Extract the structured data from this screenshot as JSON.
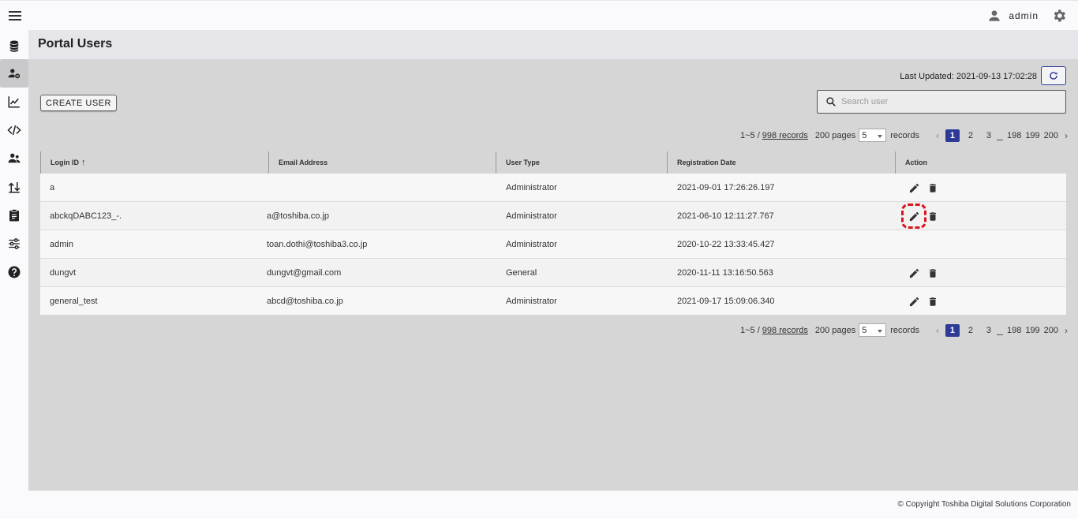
{
  "header": {
    "username": "admin"
  },
  "page": {
    "title": "Portal Users"
  },
  "toolbar": {
    "last_updated": "Last Updated: 2021-09-13 17:02:28",
    "create_label": "CREATE USER",
    "search_placeholder": "Search user"
  },
  "pagination": {
    "range": "1~5 /",
    "records_link": "998 records",
    "pages_count": "200 pages",
    "page_size": "5",
    "records_word": "records",
    "pages": [
      "1",
      "2",
      "3",
      "198",
      "199",
      "200"
    ]
  },
  "table": {
    "headers": [
      "Login ID",
      "Email Address",
      "User Type",
      "Registration Date",
      "Action"
    ],
    "rows": [
      {
        "login": "a",
        "email": "",
        "type": "Administrator",
        "date": "2021-09-01 17:26:26.197"
      },
      {
        "login": "abckqDABC123_-.",
        "email": "a@toshiba.co.jp",
        "type": "Administrator",
        "date": "2021-06-10 12:11:27.767"
      },
      {
        "login": "admin",
        "email": "toan.dothi@toshiba3.co.jp",
        "type": "Administrator",
        "date": "2020-10-22 13:33:45.427"
      },
      {
        "login": "dungvt",
        "email": "dungvt@gmail.com",
        "type": "General",
        "date": "2020-11-11 13:16:50.563"
      },
      {
        "login": "general_test",
        "email": "abcd@toshiba.co.jp",
        "type": "Administrator",
        "date": "2021-09-17 15:09:06.340"
      }
    ]
  },
  "footer": {
    "copyright": "© Copyright Toshiba Digital Solutions Corporation"
  },
  "colors": {
    "accent": "#2d3b96",
    "highlight": "#d9141c"
  },
  "sidebar": {
    "icons": [
      "database-icon",
      "user-settings-icon",
      "chart-line-icon",
      "code-icon",
      "users-icon",
      "transfer-icon",
      "clipboard-icon",
      "settings-tune-icon",
      "help-icon"
    ]
  }
}
